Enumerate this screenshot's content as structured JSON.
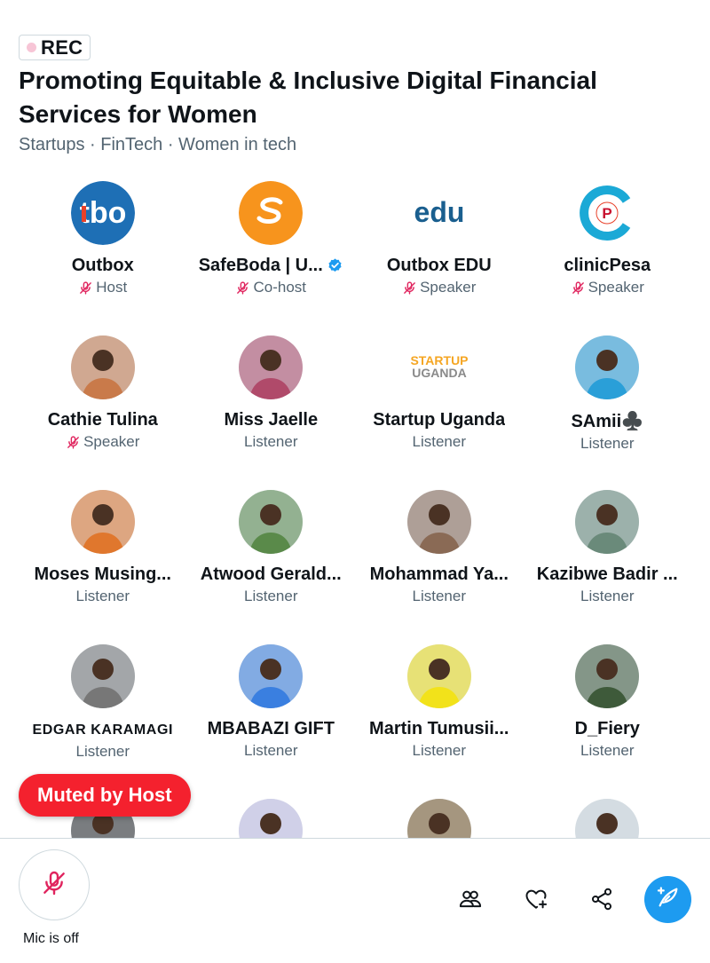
{
  "rec_label": "REC",
  "space": {
    "title": "Promoting Equitable & Inclusive  Digital Financial Services for Women",
    "topics": "Startups · FinTech · Women in tech"
  },
  "participants": [
    {
      "name": "Outbox",
      "role": "Host",
      "mic": true,
      "verified": false,
      "avatar": "tbo-logo",
      "color": "#1e6fb5"
    },
    {
      "name": "SafeBoda | U...",
      "role": "Co-host",
      "mic": true,
      "verified": true,
      "avatar": "safeboda-logo",
      "color": "#f7941d"
    },
    {
      "name": "Outbox EDU",
      "role": "Speaker",
      "mic": true,
      "verified": false,
      "avatar": "edu-logo",
      "color": "#1a5f8f"
    },
    {
      "name": "clinicPesa",
      "role": "Speaker",
      "mic": true,
      "verified": false,
      "avatar": "clinicpesa-logo",
      "color": "#1ba9d6"
    },
    {
      "name": "Cathie Tulina",
      "role": "Speaker",
      "mic": true,
      "verified": false,
      "avatar": "photo",
      "color": "#c97a4a"
    },
    {
      "name": "Miss Jaelle",
      "role": "Listener",
      "mic": false,
      "verified": false,
      "avatar": "photo",
      "color": "#b04a6a"
    },
    {
      "name": "Startup Uganda",
      "role": "Listener",
      "mic": false,
      "verified": false,
      "avatar": "startup-uganda-logo",
      "color": "#f5a623"
    },
    {
      "name": "SAmii♣️",
      "role": "Listener",
      "mic": false,
      "verified": false,
      "avatar": "photo",
      "color": "#2a9fd8"
    },
    {
      "name": "Moses Musing...",
      "role": "Listener",
      "mic": false,
      "verified": false,
      "avatar": "photo",
      "color": "#e0772d"
    },
    {
      "name": "Atwood Gerald...",
      "role": "Listener",
      "mic": false,
      "verified": false,
      "avatar": "photo",
      "color": "#5a8a4a"
    },
    {
      "name": "Mohammad Ya...",
      "role": "Listener",
      "mic": false,
      "verified": false,
      "avatar": "photo",
      "color": "#8a6a55"
    },
    {
      "name": "Kazibwe Badir ...",
      "role": "Listener",
      "mic": false,
      "verified": false,
      "avatar": "photo",
      "color": "#6a8a7a"
    },
    {
      "name": "EDGAR KARAMAGI",
      "role": "Listener",
      "mic": false,
      "verified": false,
      "avatar": "photo",
      "color": "#777777",
      "caps": true
    },
    {
      "name": "MBABAZI GIFT",
      "role": "Listener",
      "mic": false,
      "verified": false,
      "avatar": "photo",
      "color": "#3a7fe0"
    },
    {
      "name": "Martin Tumusii...",
      "role": "Listener",
      "mic": false,
      "verified": false,
      "avatar": "photo",
      "color": "#f2e21a"
    },
    {
      "name": "D_Fiery",
      "role": "Listener",
      "mic": false,
      "verified": false,
      "avatar": "photo",
      "color": "#3e5a3a"
    }
  ],
  "partial_avatars": [
    {
      "color": "#2b2b2b"
    },
    {
      "color": "#c9c2ea"
    },
    {
      "color": "#7a5a2a"
    },
    {
      "color": "#cfd9de"
    }
  ],
  "toast": "Muted by Host",
  "mic_label": "Mic is off",
  "icons": {
    "mic_off": "mic-off-icon",
    "people": "people-icon",
    "heart_plus": "heart-plus-icon",
    "share": "share-icon",
    "compose": "compose-icon",
    "verified": "verified-badge-icon"
  },
  "colors": {
    "accent": "#1d9bf0",
    "mute_red": "#f4212e",
    "rec_dot": "#f7c5d6",
    "mic_off_icon": "#e0245e"
  }
}
